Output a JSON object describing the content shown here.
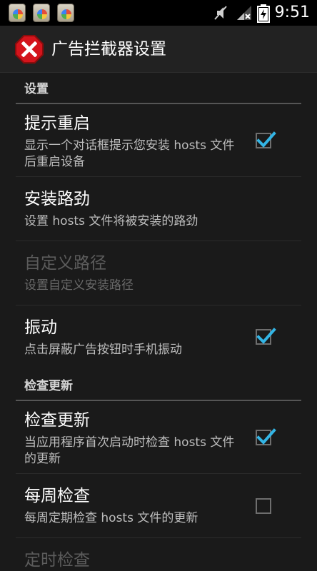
{
  "status_bar": {
    "time": "9:51",
    "notification_icons": [
      "app-notification-icon",
      "app-notification-icon",
      "app-notification-icon"
    ],
    "icons": [
      "mute-icon",
      "signal-icon",
      "battery-icon"
    ]
  },
  "action_bar": {
    "icon": "stop-x-icon",
    "title": "广告拦截器设置"
  },
  "categories": [
    {
      "label": "设置"
    },
    {
      "label": "检查更新"
    }
  ],
  "preferences": [
    {
      "title": "提示重启",
      "summary": "显示一个对话框提示您安装 hosts 文件后重启设备",
      "checked": true,
      "enabled": true
    },
    {
      "title": "安装路劲",
      "summary": "设置 hosts 文件将被安装的路劲",
      "enabled": true
    },
    {
      "title": "自定义路径",
      "summary": "设置自定义安装路径",
      "enabled": false
    },
    {
      "title": "振动",
      "summary": "点击屏蔽广告按钮时手机振动",
      "checked": true,
      "enabled": true
    },
    {
      "title": "检查更新",
      "summary": "当应用程序首次启动时检查 hosts 文件的更新",
      "checked": true,
      "enabled": true
    },
    {
      "title": "每周检查",
      "summary": "每周定期检查 hosts 文件的更新",
      "checked": false,
      "enabled": true
    },
    {
      "title": "定时检查",
      "summary": "",
      "enabled": false
    }
  ],
  "colors": {
    "background": "#1a1a1a",
    "accent": "#33b5e5",
    "divider": "#555555"
  }
}
